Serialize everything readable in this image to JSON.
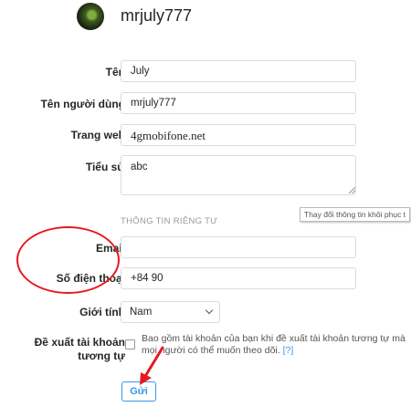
{
  "profile": {
    "username": "mrjuly777"
  },
  "fields": {
    "name": {
      "label": "Tên",
      "value": "July"
    },
    "username": {
      "label": "Tên người dùng",
      "value": "mrjuly777"
    },
    "website": {
      "label": "Trang web",
      "value": "4gmobifone.net"
    },
    "bio": {
      "label": "Tiểu sử",
      "value": "abc"
    }
  },
  "tooltip": "Thay đổi thông tin khôi phục t",
  "private_section": {
    "title": "THÔNG TIN RIÊNG TƯ",
    "email": {
      "label": "Email",
      "value": ""
    },
    "phone": {
      "label": "Số điện thoại",
      "value": "+84 90"
    },
    "gender": {
      "label": "Giới tính",
      "value": "Nam"
    }
  },
  "suggest": {
    "label_line1": "Đề xuất tài khoản",
    "label_line2": "tương tự",
    "text": "Bao gồm tài khoản của bạn khi đề xuất tài khoản tương tự mà mọi người có thể muốn theo dõi.",
    "help": "[?]",
    "checked": false
  },
  "submit_label": "Gửi",
  "annotation_color": "#e8191f",
  "accent_color": "#3897f0"
}
